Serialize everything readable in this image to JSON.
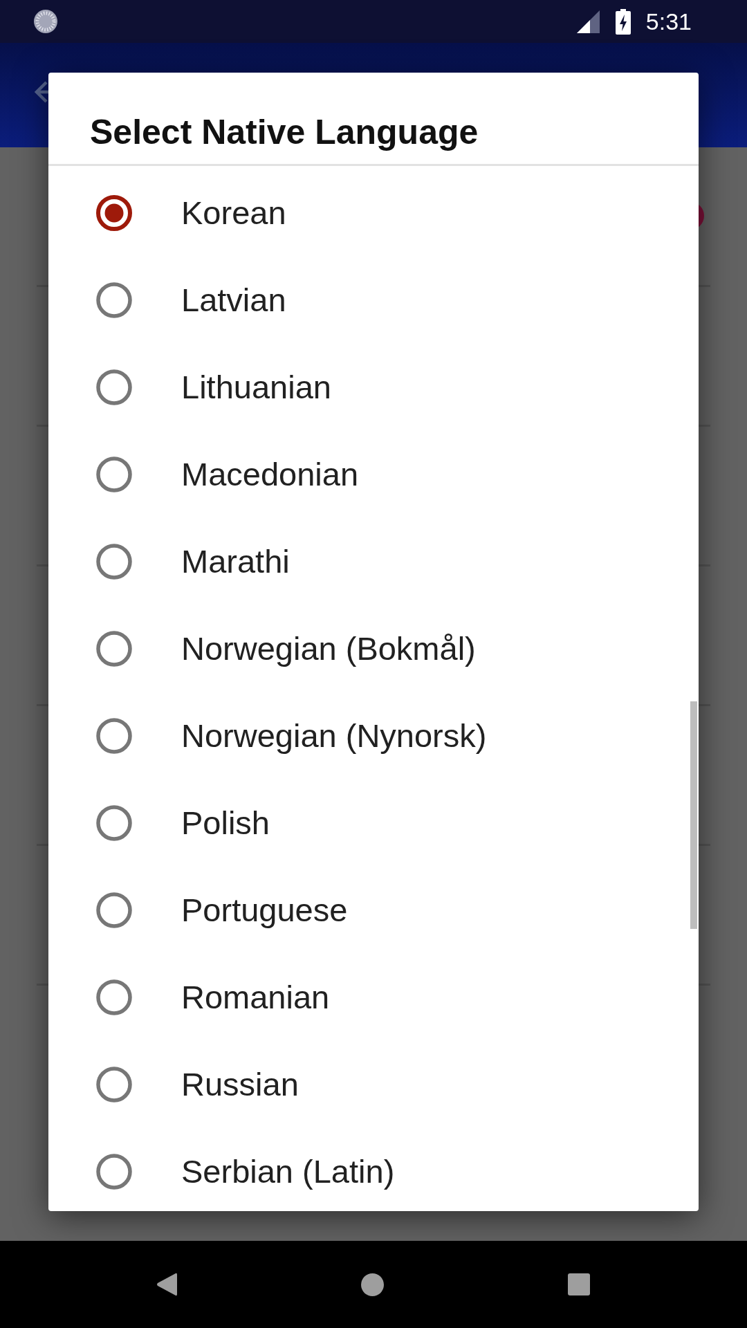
{
  "status_bar": {
    "time": "5:31"
  },
  "dialog": {
    "title": "Select Native Language",
    "options": [
      {
        "label": "Korean",
        "selected": true
      },
      {
        "label": "Latvian",
        "selected": false
      },
      {
        "label": "Lithuanian",
        "selected": false
      },
      {
        "label": "Macedonian",
        "selected": false
      },
      {
        "label": "Marathi",
        "selected": false
      },
      {
        "label": "Norwegian (Bokmål)",
        "selected": false
      },
      {
        "label": "Norwegian (Nynorsk)",
        "selected": false
      },
      {
        "label": "Polish",
        "selected": false
      },
      {
        "label": "Portuguese",
        "selected": false
      },
      {
        "label": "Romanian",
        "selected": false
      },
      {
        "label": "Russian",
        "selected": false
      },
      {
        "label": "Serbian (Latin)",
        "selected": false
      }
    ]
  }
}
